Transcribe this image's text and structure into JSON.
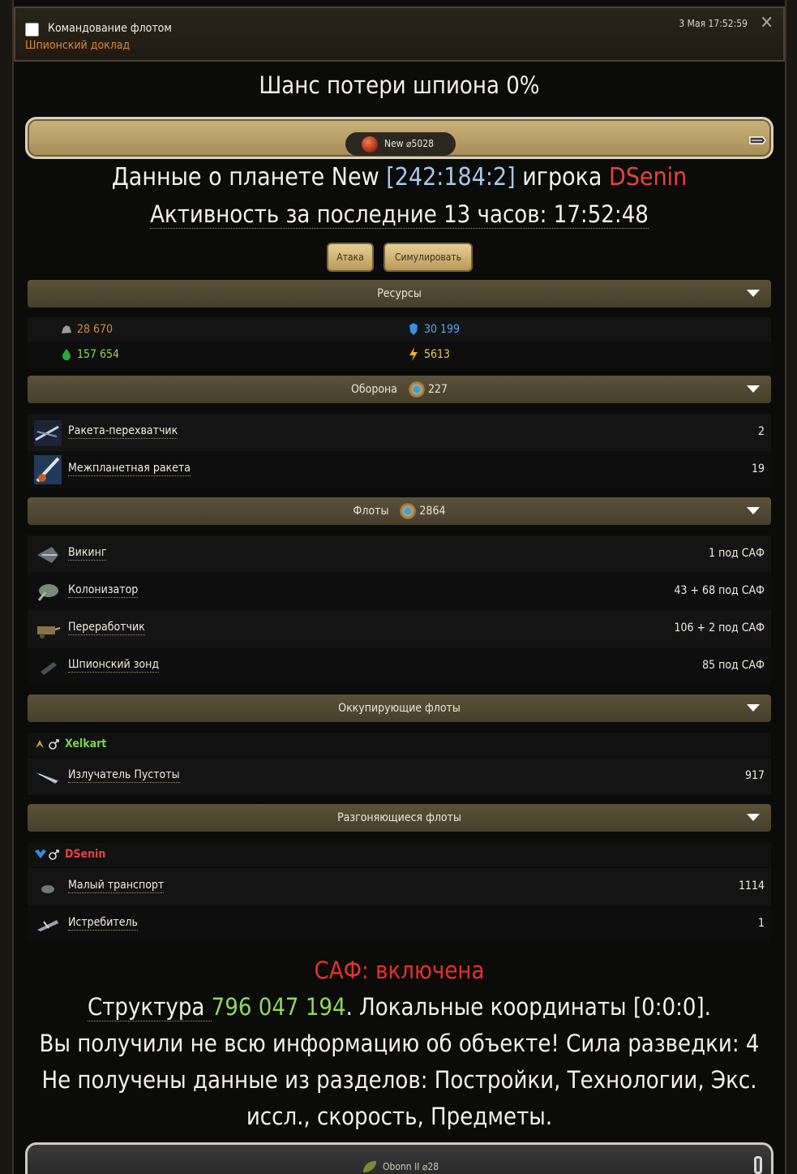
{
  "header": {
    "title": "Командование флотом",
    "subtitle": "Шпионский доклад",
    "date": "3 Мая 17:52:59",
    "close": "✕"
  },
  "chance": "Шанс потери шпиона 0%",
  "planet_pill": "New ⌀5028",
  "planet_info": {
    "prefix": "Данные о планете New ",
    "coords": "[242:184:2]",
    "mid": " игрока ",
    "player": "DSenin"
  },
  "activity": "Активность за последние 13 часов: 17:52:48",
  "buttons": {
    "attack": "Атака",
    "simulate": "Симулировать"
  },
  "sections": {
    "resources": "Ресурсы",
    "defense": "Оборона",
    "defense_count": "227",
    "fleets": "Флоты",
    "fleets_count": "2864",
    "occupying": "Оккупирующие флоты",
    "dispersing": "Разгоняющиеся флоты"
  },
  "resources": {
    "metal": "28 670",
    "crystal": "30 199",
    "deuterium": "157 654",
    "energy": "5613"
  },
  "defense": [
    {
      "name": "Ракета-перехватчик",
      "value": "2"
    },
    {
      "name": "Межпланетная ракета",
      "value": "19"
    }
  ],
  "fleets": [
    {
      "name": "Викинг",
      "value": "1 под САФ"
    },
    {
      "name": "Колонизатор",
      "value": "43 + 68 под САФ"
    },
    {
      "name": "Переработчик",
      "value": "106 + 2 под САФ"
    },
    {
      "name": "Шпионский зонд",
      "value": "85 под САФ"
    }
  ],
  "occupying": {
    "player": "Xelkart",
    "ships": [
      {
        "name": "Излучатель Пустоты",
        "value": "917"
      }
    ]
  },
  "dispersing": {
    "player": "DSenin",
    "ships": [
      {
        "name": "Малый транспорт",
        "value": "1114"
      },
      {
        "name": "Истребитель",
        "value": "1"
      }
    ]
  },
  "saf_status": "САФ: включена",
  "structure": {
    "prefix": "Структура ",
    "value": "796 047 194",
    "suffix": ". Локальные координаты [0:0:0]."
  },
  "incomplete": "Вы получили не всю информацию об объекте! Сила разведки: 4",
  "missing_line1": "Не получены данные из разделов: Постройки, Технологии, Экс.",
  "missing_line2": "иссл., скорость, Предметы.",
  "bottom_planet": "Obonn II ⌀28",
  "colors": {
    "accent_orange": "#e0823a",
    "coords_blue": "#a9c8e8",
    "player_red": "#e8443a",
    "xelkart_green": "#7ad24a",
    "structure_green": "#8ed85a",
    "saf_red": "#e8302a"
  }
}
